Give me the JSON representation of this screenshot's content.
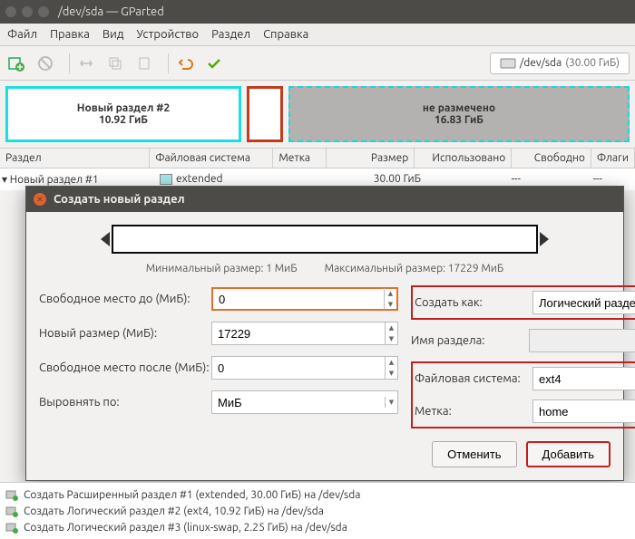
{
  "window": {
    "title": "/dev/sda — GParted"
  },
  "menu": [
    "Файл",
    "Правка",
    "Вид",
    "Устройство",
    "Раздел",
    "Справка"
  ],
  "device": {
    "path": "/dev/sda",
    "size": "(30.00 ГиБ)"
  },
  "diskmap": {
    "p1": {
      "name": "Новый раздел #2",
      "size": "10.92 ГиБ"
    },
    "unalloc": {
      "name": "не размечено",
      "size": "16.83 ГиБ"
    }
  },
  "columns": {
    "partition": "Раздел",
    "fs": "Файловая система",
    "label": "Метка",
    "size": "Размер",
    "used": "Использовано",
    "free": "Свободно",
    "flags": "Флаги"
  },
  "rows": [
    {
      "partition": "Новый раздел #1",
      "fs": "extended",
      "label": "",
      "size": "30.00 ГиБ",
      "used": "---",
      "free": "---",
      "flags": ""
    }
  ],
  "dialog": {
    "title": "Создать новый раздел",
    "min_size": "Минимальный размер: 1 МиБ",
    "max_size": "Максимальный размер: 17229 МиБ",
    "labels": {
      "free_before": "Свободное место до (МиБ):",
      "new_size": "Новый размер (МиБ):",
      "free_after": "Свободное место после (МиБ):",
      "align": "Выровнять по:",
      "create_as": "Создать как:",
      "part_name": "Имя раздела:",
      "fs": "Файловая система:",
      "vlabel": "Метка:"
    },
    "values": {
      "free_before": "0",
      "new_size": "17229",
      "free_after": "0",
      "align": "МиБ",
      "create_as": "Логический раздел",
      "part_name": "",
      "fs": "ext4",
      "vlabel": "home"
    },
    "buttons": {
      "cancel": "Отменить",
      "add": "Добавить"
    }
  },
  "pending": [
    "Создать Расширенный раздел #1 (extended, 30.00 ГиБ) на /dev/sda",
    "Создать Логический раздел #2 (ext4, 10.92 ГиБ) на /dev/sda",
    "Создать Логический раздел #3 (linux-swap, 2.25 ГиБ) на /dev/sda"
  ]
}
